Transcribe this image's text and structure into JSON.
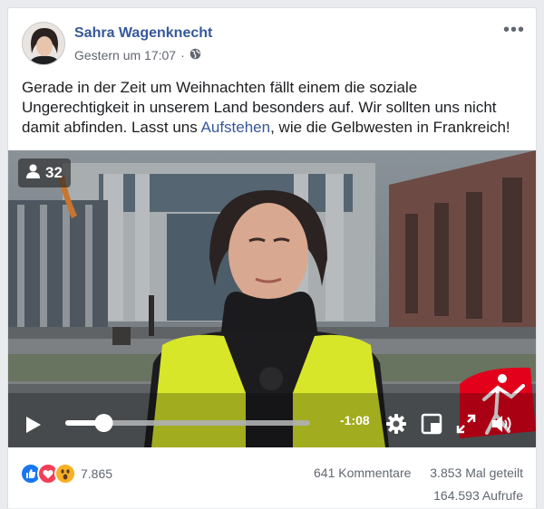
{
  "post": {
    "author": "Sahra Wagenknecht",
    "time": "Gestern um 17:07",
    "separator": "·",
    "text_before_link": "Gerade in der Zeit um Weihnachten fällt einem die soziale Ungerechtigkeit in unserem Land besonders auf. Wir sollten uns nicht damit abfinden. Lasst uns ",
    "link_text": "Aufstehen",
    "text_after_link": ", wie die Gelbwesten in Frankreich!"
  },
  "video": {
    "viewer_count": "32",
    "time_remaining": "-1:08",
    "progress": 0.15,
    "volume": 0.55
  },
  "stats": {
    "reaction_count": "7.865",
    "comments": "641 Kommentare",
    "shares": "3.853 Mal geteilt",
    "views": "164.593 Aufrufe"
  },
  "colors": {
    "link": "#365899",
    "like": "#1877f2",
    "love": "#f33e58",
    "wow": "#f7b125",
    "vest": "#d8e62a",
    "logo": "#e3001b"
  },
  "icons": [
    "globe-icon",
    "more-icon",
    "viewer-icon",
    "play-icon",
    "gear-icon",
    "exit-fullscreen-icon",
    "fullscreen-icon",
    "volume-icon",
    "like-icon",
    "love-icon",
    "wow-icon"
  ]
}
